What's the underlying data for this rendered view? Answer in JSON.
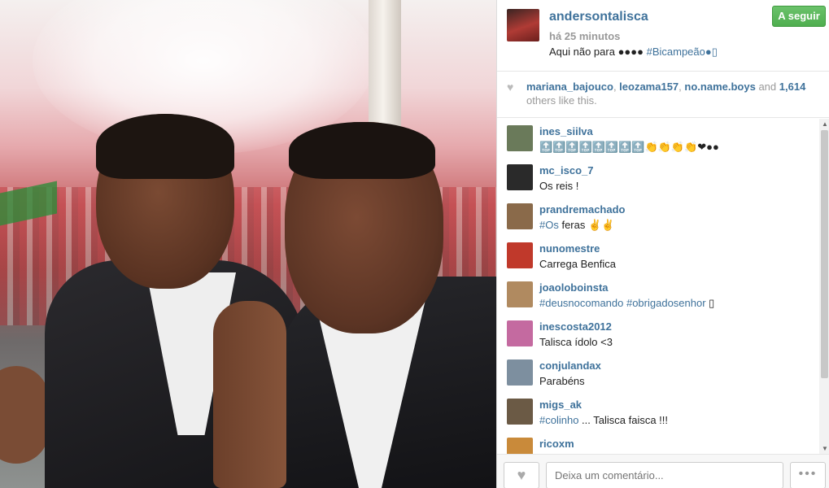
{
  "post": {
    "username": "andersontalisca",
    "time": "há 25 minutos",
    "caption_text": "Aqui não para ●●●● ",
    "caption_tag": "#Bicampeão",
    "caption_tail": "●▯",
    "follow_label": "A seguir"
  },
  "likes": {
    "user1": "mariana_bajouco",
    "user2": "leozama157",
    "user3": "no.name.boys",
    "and": "and",
    "count": "1,614",
    "suffix": "others like this."
  },
  "comments": [
    {
      "user": "ines_siilva",
      "pre": "",
      "tag": "",
      "text": "🔝🔝🔝🔝🔝🔝🔝🔝👏👏👏👏❤●●",
      "avatar_color": "#6a7a5a"
    },
    {
      "user": "mc_isco_7",
      "pre": "",
      "tag": "",
      "text": "Os reis !",
      "avatar_color": "#2a2a2a"
    },
    {
      "user": "prandremachado",
      "pre": "",
      "tag": "#Os",
      "text": " feras ✌✌",
      "avatar_color": "#8a6a4a"
    },
    {
      "user": "nunomestre",
      "pre": "",
      "tag": "",
      "text": "Carrega Benfica",
      "avatar_color": "#c0392b"
    },
    {
      "user": "joaoloboinsta",
      "pre": "",
      "tag": "#deusnocomando #obrigadosenhor",
      "text": " ▯",
      "avatar_color": "#b08a60"
    },
    {
      "user": "inescosta2012",
      "pre": "",
      "tag": "",
      "text": "Talisca ídolo <3",
      "avatar_color": "#c46aa0"
    },
    {
      "user": "conjulandax",
      "pre": "",
      "tag": "",
      "text": "Parabéns",
      "avatar_color": "#7d8f9f"
    },
    {
      "user": "migs_ak",
      "pre": "",
      "tag": "#colinho",
      "text": " ... Talisca faisca !!!",
      "avatar_color": "#6b5a45"
    },
    {
      "user": "ricoxm",
      "pre": "",
      "tag": "",
      "text": "",
      "avatar_color": "#c98a3a"
    }
  ],
  "footer": {
    "comment_placeholder": "Deixa um comentário...",
    "more_label": "•••"
  },
  "colors": {
    "link": "#3f729b",
    "follow": "#4fae4f"
  },
  "icons": {
    "like": "heart-icon",
    "more": "ellipsis-icon"
  }
}
